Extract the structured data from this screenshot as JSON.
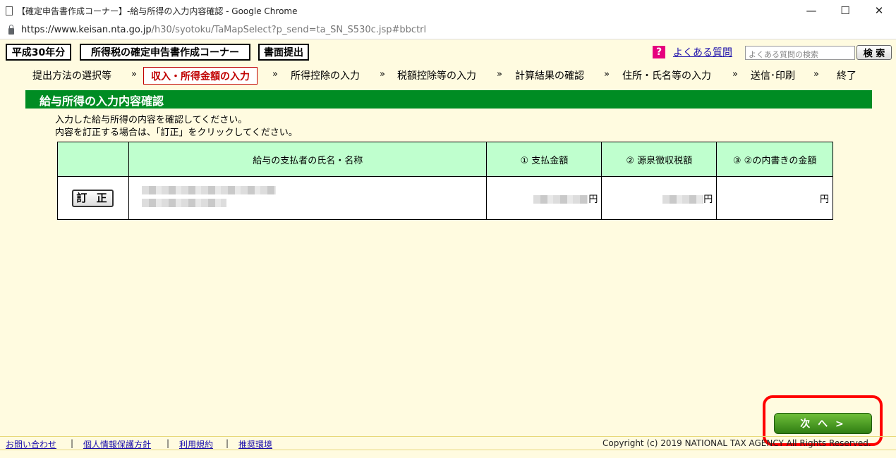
{
  "window": {
    "title": "【確定申告書作成コーナー】-給与所得の入力内容確認 - Google Chrome",
    "controls": {
      "minimize": "—",
      "maximize": "☐",
      "close": "✕"
    }
  },
  "address_bar": {
    "host": "https://www.keisan.nta.go.jp",
    "path": "/h30/syotoku/TaMapSelect?p_send=ta_SN_S530c.jsp#bbctrl"
  },
  "header": {
    "year": "平成30年分",
    "corner": "所得税の確定申告書作成コーナー",
    "mode": "書面提出",
    "faq_icon": "?",
    "faq_link": "よくある質問",
    "search_placeholder": "よくある質問の検索",
    "search_button": "検 索"
  },
  "steps": {
    "items": [
      "提出方法の選択等",
      "収入・所得金額の入力",
      "所得控除の入力",
      "税額控除等の入力",
      "計算結果の確認",
      "住所・氏名等の入力",
      "送信･印刷",
      "終了"
    ],
    "separator": "»",
    "active_index": 1
  },
  "section": {
    "title": "給与所得の入力内容確認",
    "instruction_1": "入力した給与所得の内容を確認してください。",
    "instruction_2": "内容を訂正する場合は、「訂正」をクリックしてください。"
  },
  "table": {
    "headers": [
      "",
      "給与の支払者の氏名・名称",
      "① 支払金額",
      "② 源泉徴収税額",
      "③ ②の内書きの金額"
    ],
    "row": {
      "correct_button": "訂 正",
      "amount_unit_1": "円",
      "amount_unit_2": "円",
      "amount_unit_3": "円"
    }
  },
  "next_button": "次 へ >",
  "footer": {
    "links": [
      "お問い合わせ",
      "個人情報保護方針",
      "利用規約",
      "推奨環境"
    ],
    "separator": "|",
    "copyright": "Copyright (c) 2019 NATIONAL TAX AGENCY All Rights Reserved."
  },
  "colors": {
    "page_bg": "#fffbe0",
    "section_green": "#008c23",
    "table_header_bg": "#bfffce",
    "active_step": "#c00000",
    "highlight": "#ff0000"
  }
}
